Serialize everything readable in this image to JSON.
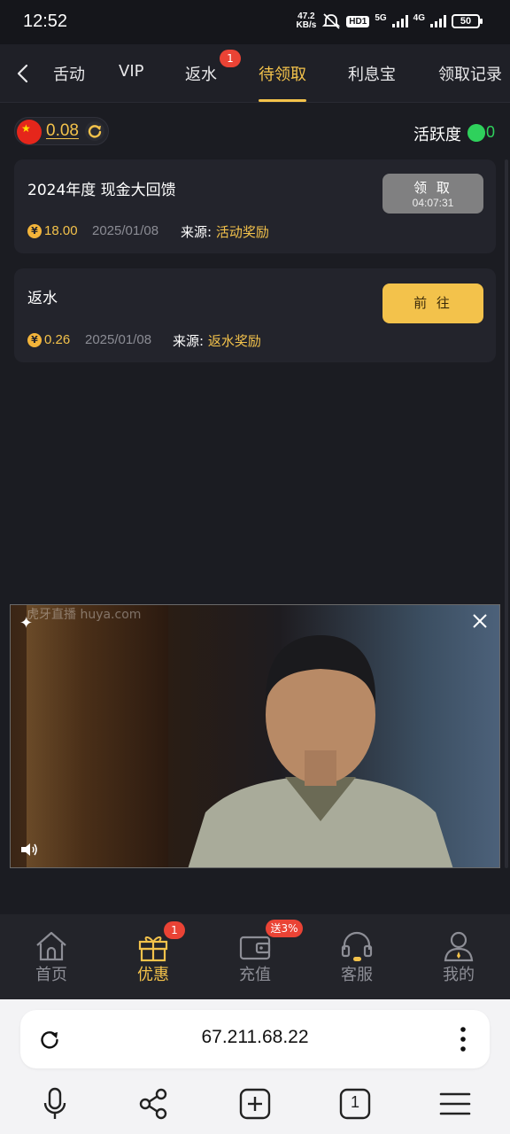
{
  "status_bar": {
    "time": "12:52",
    "net_speed_value": "47.2",
    "net_speed_unit": "KB/s",
    "hd_label": "HD1",
    "network_1": "5G",
    "network_2": "4G",
    "battery": "50"
  },
  "tabs": [
    {
      "label": "活动",
      "visible_text": "舌动"
    },
    {
      "label": "VIP"
    },
    {
      "label": "返水",
      "badge": "1"
    },
    {
      "label": "待领取",
      "active": true
    },
    {
      "label": "利息宝"
    },
    {
      "label": "领取记录"
    }
  ],
  "balance": {
    "amount": "0.08"
  },
  "activity": {
    "label": "活跃度",
    "value": "0"
  },
  "rewards": [
    {
      "title": "2024年度 现金大回馈",
      "amount": "18.00",
      "date": "2025/01/08",
      "source_label": "来源: ",
      "source_value": "活动奖励",
      "button_label": "领 取",
      "button_timer": "04:07:31",
      "button_state": "disabled"
    },
    {
      "title": "返水",
      "amount": "0.26",
      "date": "2025/01/08",
      "source_label": "来源: ",
      "source_value": "返水奖励",
      "button_label": "前 往",
      "button_state": "enabled"
    }
  ],
  "video": {
    "watermark": "虎牙直播 huya.com"
  },
  "bottom_nav": [
    {
      "label": "首页",
      "icon": "home-icon"
    },
    {
      "label": "优惠",
      "icon": "gift-icon",
      "badge": "1",
      "active": true
    },
    {
      "label": "充值",
      "icon": "wallet-icon",
      "badge": "送3%"
    },
    {
      "label": "客服",
      "icon": "headset-icon"
    },
    {
      "label": "我的",
      "icon": "user-icon"
    }
  ],
  "browser": {
    "url": "67.211.68.22",
    "tab_count": "1"
  },
  "colors": {
    "accent": "#f3c24b",
    "background": "#1b1c22",
    "card": "#23242c",
    "green": "#2fd15c",
    "badge_red": "#ea4335"
  }
}
